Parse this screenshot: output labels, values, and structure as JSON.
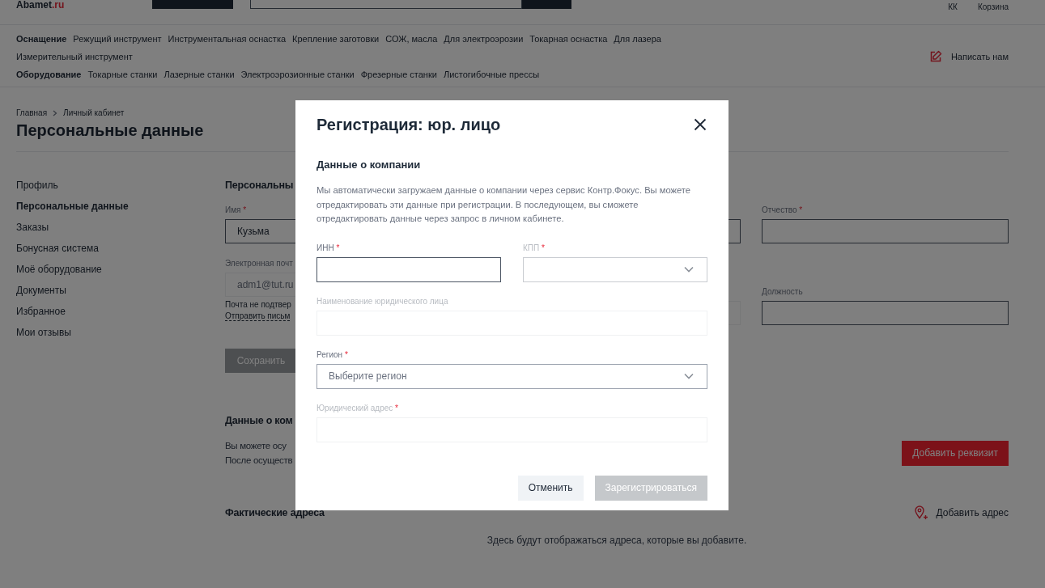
{
  "header": {
    "logo": {
      "name": "Abamet",
      "suffix": ".ru"
    },
    "account_label": "КК",
    "cart_label": "Корзина"
  },
  "nav": {
    "groups": [
      {
        "title": "Оснащение",
        "links": [
          "Режущий инструмент",
          "Инструментальная оснастка",
          "Крепление заготовки",
          "СОЖ, масла",
          "Для электроэрозии",
          "Токарная оснастка",
          "Для лазера",
          "Измерительный инструмент"
        ]
      },
      {
        "title": "Оборудование",
        "links": [
          "Токарные станки",
          "Лазерные станки",
          "Электроэрозионные станки",
          "Фрезерные станки",
          "Листогибочные прессы"
        ]
      }
    ],
    "contact": "Написать нам"
  },
  "breadcrumb": [
    "Главная",
    "Личный кабинет"
  ],
  "page_title": "Персональные данные",
  "sidebar": {
    "items": [
      {
        "label": "Профиль",
        "selected": false
      },
      {
        "label": "Персональные данные",
        "selected": true
      },
      {
        "label": "Заказы",
        "selected": false
      },
      {
        "label": "Бонусная система",
        "selected": false
      },
      {
        "label": "Моё оборудование",
        "selected": false
      },
      {
        "label": "Документы",
        "selected": false
      },
      {
        "label": "Избранное",
        "selected": false
      },
      {
        "label": "Мои отзывы",
        "selected": false
      }
    ]
  },
  "personal": {
    "heading": "Персональны",
    "columns": [
      {
        "fields": [
          {
            "label": "Имя",
            "required_mark": "*",
            "value": "Кузьма",
            "disabled": false
          },
          {
            "label": "Электронная почт",
            "value": "adm1@tut.ru",
            "disabled": true,
            "note": "Почта не подтвер",
            "link": "Отправить письм"
          }
        ]
      },
      {
        "fields": [
          {
            "disabled": false
          },
          {
            "disabled": true
          }
        ]
      },
      {
        "fields": [
          {
            "label": "Отчество",
            "required_mark": "*",
            "disabled": false
          },
          {
            "label": "Должность",
            "disabled": false
          }
        ]
      }
    ],
    "save_button": {
      "label": "Сохранить",
      "disabled": true
    }
  },
  "company": {
    "heading": "Данные о ком",
    "lines": [
      "Вы можете осу",
      "После осуществ"
    ],
    "add_button": "Добавить реквизит"
  },
  "addresses": {
    "heading": "Фактические адреса",
    "add_link": "Добавить адрес",
    "empty_text": "Здесь будут отображаться адреса, которые вы добавите."
  },
  "modal": {
    "title": "Регистрация: юр. лицо",
    "section_title": "Данные о компании",
    "description": "Мы автоматически загружаем данные о компании через сервис Контр.Фокус. Вы можете отредактировать эти данные при регистрации. В последующем, вы сможете отредактировать данные через запрос в личном кабинете.",
    "rows": [
      {
        "fields": [
          {
            "kind": "input",
            "label": "ИНН",
            "required_mark": "*",
            "disabled": false,
            "focused": true
          },
          {
            "kind": "select",
            "label": "КПП",
            "required_mark": "*",
            "disabled": true,
            "focused": false
          }
        ]
      },
      {
        "fields": [
          {
            "kind": "input",
            "label": "Наименование юридического лица",
            "disabled": true,
            "focused": false
          }
        ]
      },
      {
        "fields": [
          {
            "kind": "select",
            "label": "Регион",
            "required_mark": "*",
            "disabled": false,
            "focused": false,
            "placeholder": "Выберите регион"
          }
        ]
      },
      {
        "fields": [
          {
            "kind": "input",
            "label": "Юридический адрес",
            "required_mark": "*",
            "disabled": true,
            "focused": false
          }
        ]
      }
    ],
    "buttons": [
      {
        "label": "Отменить",
        "kind": "secondary",
        "disabled": false
      },
      {
        "label": "Зарегистрироваться",
        "kind": "primary",
        "disabled": true
      }
    ]
  }
}
